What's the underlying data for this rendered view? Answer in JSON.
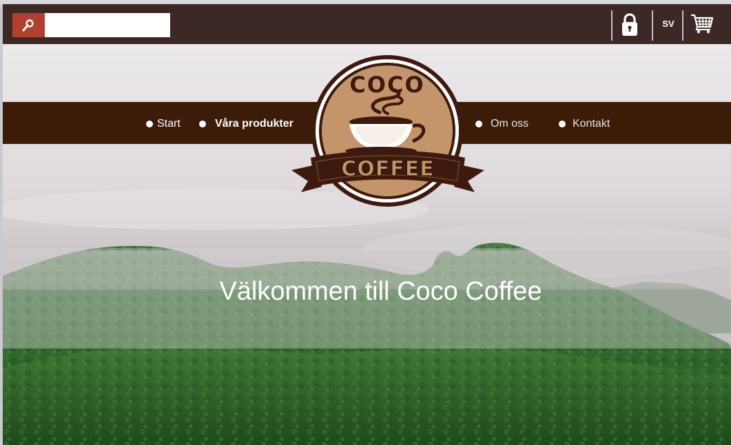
{
  "search": {
    "placeholder": "",
    "value": ""
  },
  "header": {
    "icons": [
      "search-icon",
      "lock-icon",
      "cart-icon"
    ],
    "language": "SV"
  },
  "nav": {
    "items": [
      {
        "label": "Start"
      },
      {
        "label": "Våra produkter"
      },
      {
        "label": "Om oss"
      },
      {
        "label": "Kontakt"
      }
    ]
  },
  "logo": {
    "top_text": "COCO",
    "banner_text": "COFFEE"
  },
  "hero": {
    "title": "Välkommen till Coco Coffee"
  },
  "colors": {
    "topbar": "#3c2926",
    "search_button": "#b3402e",
    "nav_band": "#3c1c09",
    "logo_brown": "#3d1a0d",
    "logo_tan": "#c4956a"
  }
}
